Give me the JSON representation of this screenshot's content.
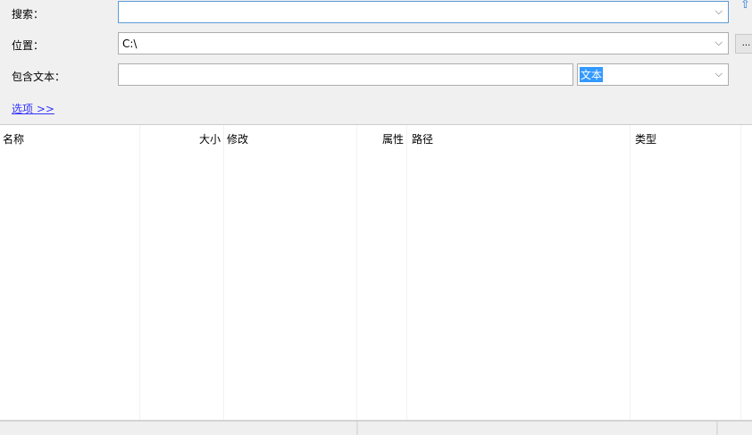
{
  "form": {
    "search_label": "搜索：",
    "search_value": "",
    "location_label": "位置：",
    "location_value": "C:\\",
    "text_label": "包含文本：",
    "text_value": "",
    "text_type": "文本",
    "browse_label": "...",
    "options_link": "选项 >>"
  },
  "columns": [
    "名称",
    "大小",
    "修改",
    "属性",
    "路径",
    "类型"
  ]
}
